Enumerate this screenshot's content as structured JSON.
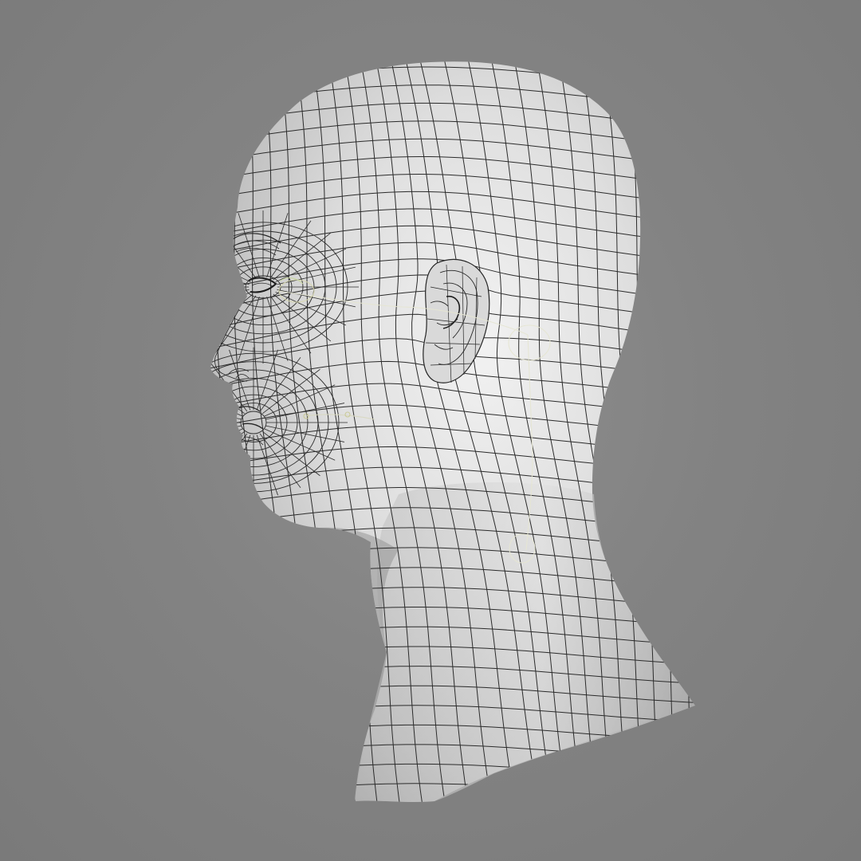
{
  "viewport": {
    "background_color": "#848484",
    "mesh_fill_color": "#cfcfcf",
    "wire_color": "#2b2b2b",
    "rig_curve_color": "#e6e6d2"
  },
  "model": {
    "subject": "head-and-neck",
    "view": "left-side-profile",
    "display": "wireframe-on-shaded"
  }
}
